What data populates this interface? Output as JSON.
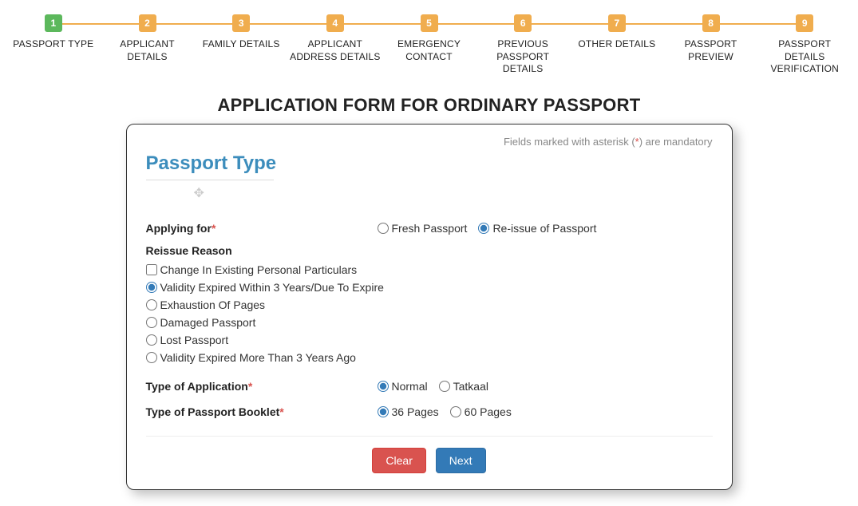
{
  "stepper": {
    "active_index": 0,
    "steps": [
      {
        "num": "1",
        "label": "PASSPORT TYPE"
      },
      {
        "num": "2",
        "label": "APPLICANT DETAILS"
      },
      {
        "num": "3",
        "label": "FAMILY DETAILS"
      },
      {
        "num": "4",
        "label": "APPLICANT ADDRESS DETAILS"
      },
      {
        "num": "5",
        "label": "EMERGENCY CONTACT"
      },
      {
        "num": "6",
        "label": "PREVIOUS PASSPORT DETAILS"
      },
      {
        "num": "7",
        "label": "OTHER DETAILS"
      },
      {
        "num": "8",
        "label": "PASSPORT PREVIEW"
      },
      {
        "num": "9",
        "label": "PASSPORT DETAILS VERIFICATION"
      }
    ]
  },
  "page_title": "APPLICATION FORM FOR ORDINARY PASSPORT",
  "mandatory_note_pre": "Fields marked with asterisk (",
  "mandatory_note_ast": "*",
  "mandatory_note_post": ") are mandatory",
  "section_heading": "Passport Type",
  "applying_for": {
    "label": "Applying for",
    "options": [
      {
        "label": "Fresh Passport",
        "checked": false
      },
      {
        "label": "Re-issue of Passport",
        "checked": true
      }
    ]
  },
  "reissue": {
    "heading": "Reissue Reason",
    "options": [
      {
        "type": "checkbox",
        "label": "Change In Existing Personal Particulars",
        "checked": false
      },
      {
        "type": "radio",
        "label": "Validity Expired Within 3 Years/Due To Expire",
        "checked": true
      },
      {
        "type": "radio",
        "label": "Exhaustion Of Pages",
        "checked": false
      },
      {
        "type": "radio",
        "label": "Damaged Passport",
        "checked": false
      },
      {
        "type": "radio",
        "label": "Lost Passport",
        "checked": false
      },
      {
        "type": "radio",
        "label": "Validity Expired More Than 3 Years Ago",
        "checked": false
      }
    ]
  },
  "app_type": {
    "label": "Type of Application",
    "options": [
      {
        "label": "Normal",
        "checked": true
      },
      {
        "label": "Tatkaal",
        "checked": false
      }
    ]
  },
  "booklet": {
    "label": "Type of Passport Booklet",
    "options": [
      {
        "label": "36 Pages",
        "checked": true
      },
      {
        "label": "60 Pages",
        "checked": false
      }
    ]
  },
  "actions": {
    "clear": "Clear",
    "next": "Next"
  }
}
